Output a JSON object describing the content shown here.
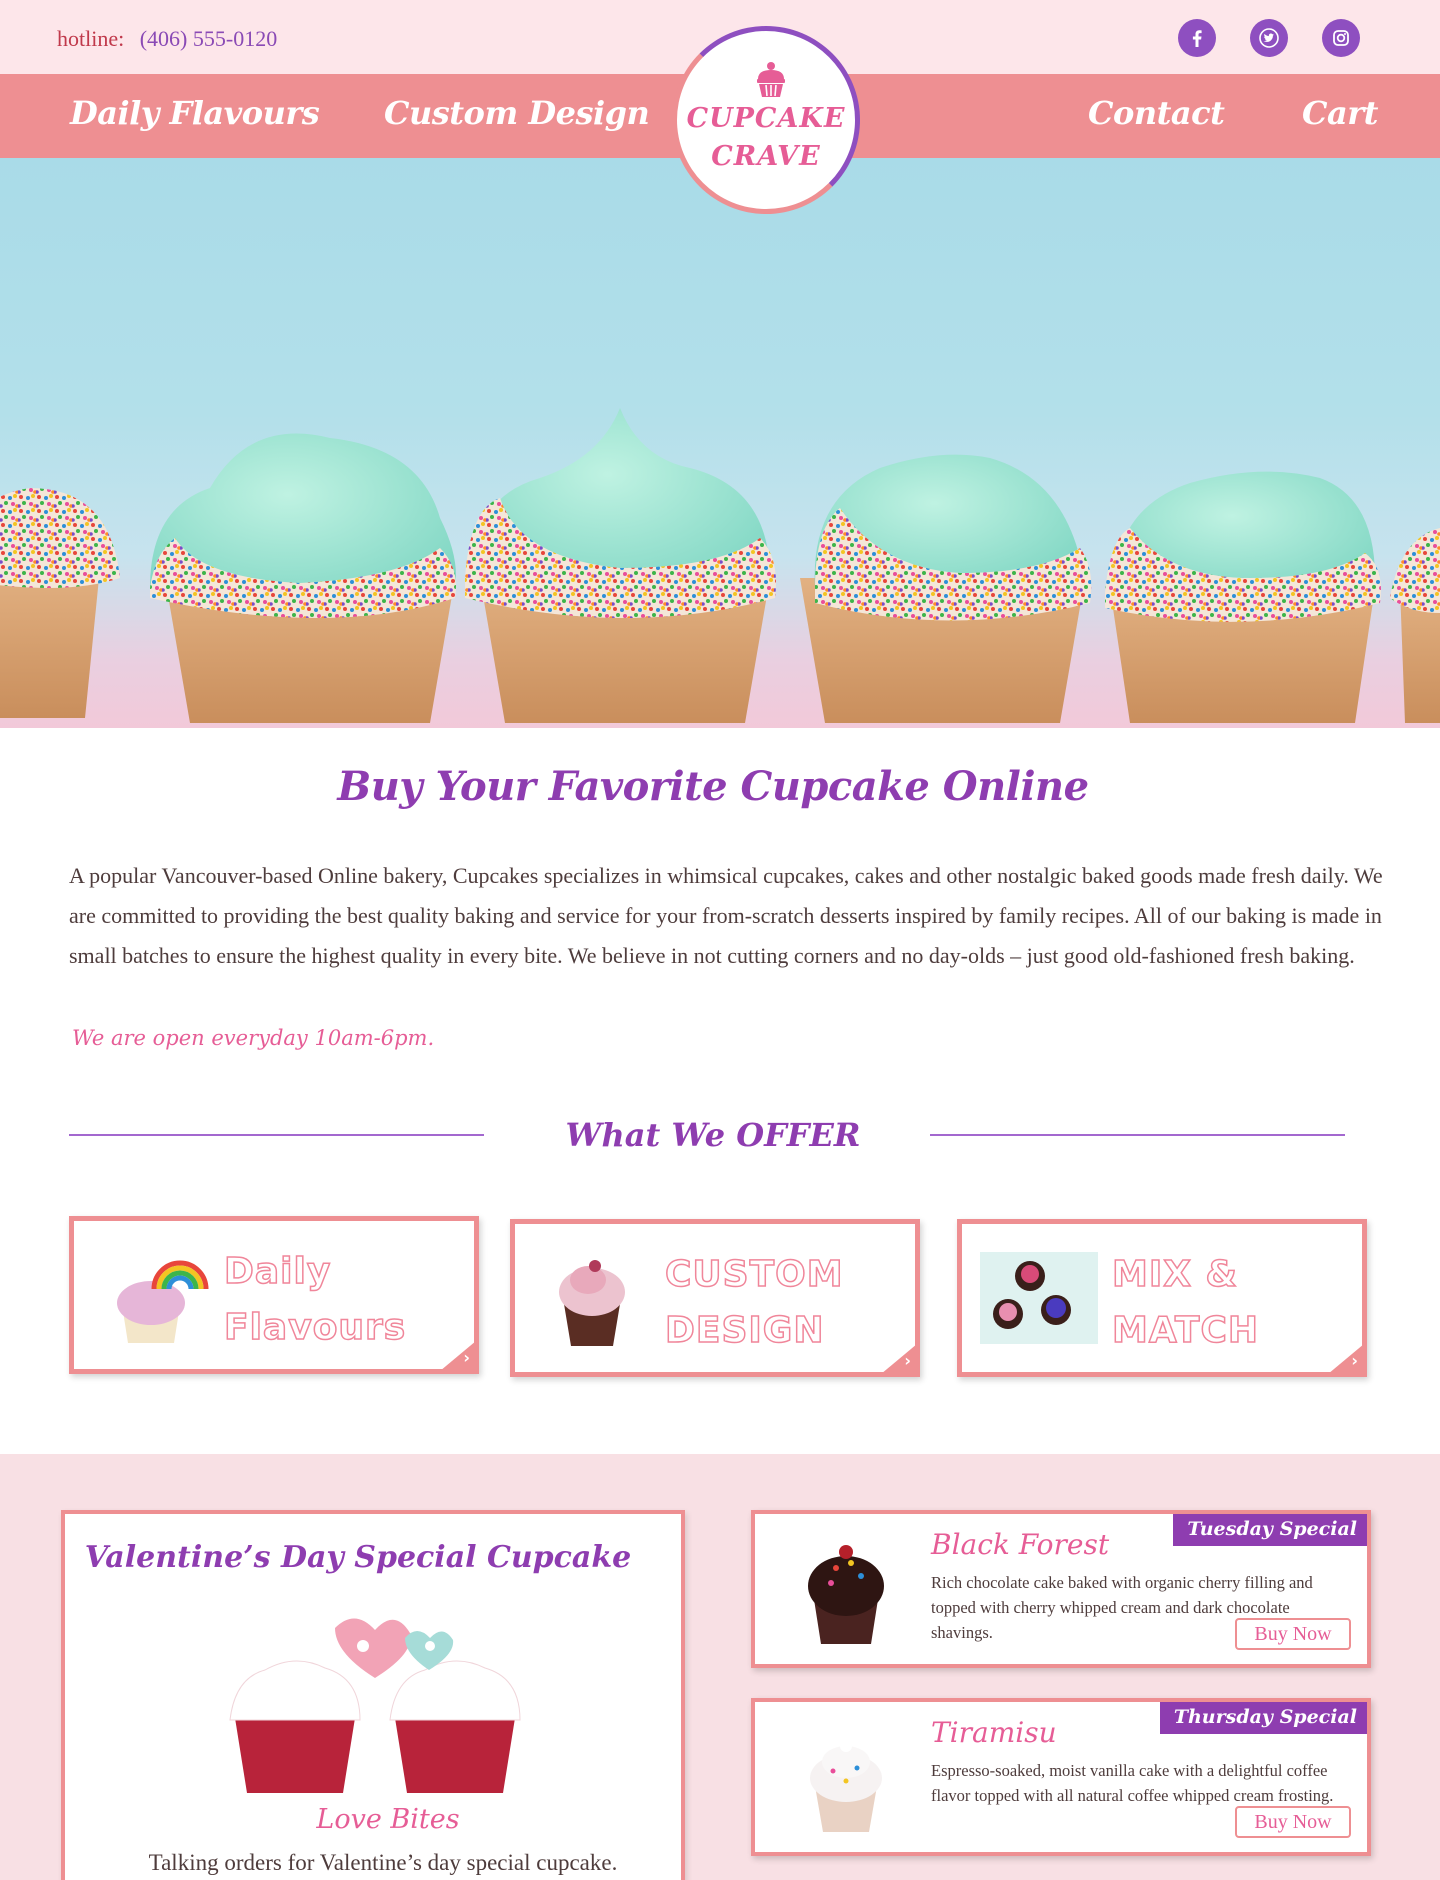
{
  "topbar": {
    "hotline_label": "hotline:",
    "hotline_number": "(406) 555-0120",
    "social": [
      "facebook-icon",
      "twitter-icon",
      "instagram-icon"
    ]
  },
  "nav": {
    "left": [
      "Daily Flavours",
      "Custom Design"
    ],
    "right": [
      "Contact",
      "Cart"
    ],
    "logo_line1": "CUPCAKE",
    "logo_line2": "CRAVE"
  },
  "intro": {
    "title": "Buy Your Favorite Cupcake Online",
    "body": "A popular Vancouver-based Online bakery, Cupcakes specializes in whimsical cupcakes, cakes and other nostalgic baked goods  made fresh daily.  We are committed to providing the best quality baking and service for your  from-scratch desserts inspired by family recipes. All of our baking is made in small batches to ensure the highest quality in every bite. We believe in not cutting corners and no day-olds – just good old-fashioned fresh baking.",
    "hours": "We are open everyday 10am-6pm."
  },
  "offer": {
    "title": "What We OFFER",
    "cards": [
      {
        "line1": "Daily",
        "line2": "Flavours"
      },
      {
        "line1": "CUSTOM",
        "line2": "DESIGN"
      },
      {
        "line1": "MIX &",
        "line2": "MATCH"
      }
    ]
  },
  "valentine": {
    "title": "Valentine’s Day Special Cupcake",
    "name": "Love Bites",
    "desc": "Talking orders for Valentine’s day special cupcake."
  },
  "specials": [
    {
      "name": "Black Forest",
      "badge": "Tuesday Special",
      "desc": "Rich chocolate cake baked with organic cherry filling and topped with cherry whipped cream and dark chocolate shavings.",
      "button": "Buy Now"
    },
    {
      "name": "Tiramisu",
      "badge": "Thursday Special",
      "desc": "Espresso-soaked, moist vanilla cake with a delightful coffee flavor topped with all natural coffee whipped cream frosting.",
      "button": "Buy Now"
    }
  ],
  "colors": {
    "topbar_bg": "#fde6ea",
    "nav_bg": "#ee8f92",
    "purple": "#8e3db0",
    "pink": "#e65d96",
    "specials_bg": "#f8e0e4"
  }
}
